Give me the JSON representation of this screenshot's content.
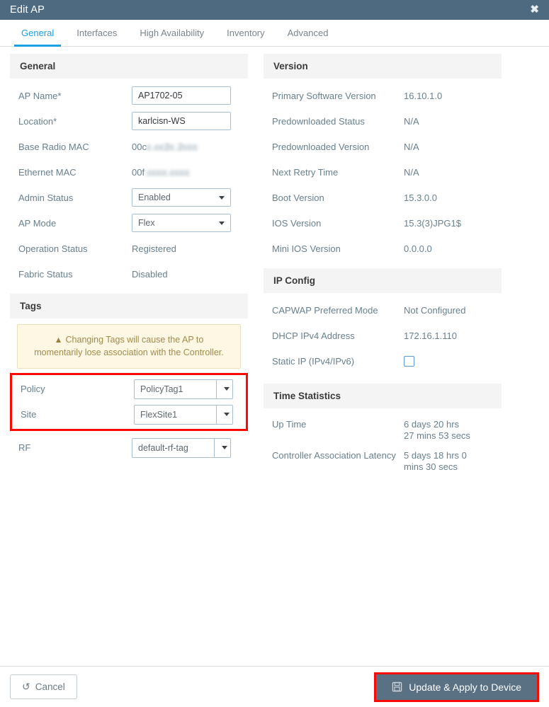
{
  "window": {
    "title": "Edit AP",
    "close_icon": "close-icon"
  },
  "tabs": [
    {
      "label": "General",
      "active": true
    },
    {
      "label": "Interfaces",
      "active": false
    },
    {
      "label": "High Availability",
      "active": false
    },
    {
      "label": "Inventory",
      "active": false
    },
    {
      "label": "Advanced",
      "active": false
    }
  ],
  "left": {
    "general": {
      "header": "General",
      "ap_name_label": "AP Name*",
      "ap_name_value": "AP1702-05",
      "location_label": "Location*",
      "location_value": "karlcisn-WS",
      "base_radio_mac_label": "Base Radio MAC",
      "base_radio_mac_visible": "00c",
      "base_radio_mac_redacted": "c.cc2c.2ccc",
      "ethernet_mac_label": "Ethernet MAC",
      "ethernet_mac_visible": "00f",
      "ethernet_mac_redacted": ".cccc.cccc",
      "admin_status_label": "Admin Status",
      "admin_status_value": "Enabled",
      "ap_mode_label": "AP Mode",
      "ap_mode_value": "Flex",
      "operation_status_label": "Operation Status",
      "operation_status_value": "Registered",
      "fabric_status_label": "Fabric Status",
      "fabric_status_value": "Disabled"
    },
    "tags": {
      "header": "Tags",
      "warning_icon": "warning-triangle-icon",
      "warning_text": "Changing Tags will cause the AP to momentarily lose association with the Controller.",
      "policy_label": "Policy",
      "policy_value": "PolicyTag1",
      "site_label": "Site",
      "site_value": "FlexSite1",
      "rf_label": "RF",
      "rf_value": "default-rf-tag"
    }
  },
  "right": {
    "version": {
      "header": "Version",
      "rows": [
        {
          "label": "Primary Software Version",
          "value": "16.10.1.0"
        },
        {
          "label": "Predownloaded Status",
          "value": "N/A"
        },
        {
          "label": "Predownloaded Version",
          "value": "N/A"
        },
        {
          "label": "Next Retry Time",
          "value": "N/A"
        },
        {
          "label": "Boot Version",
          "value": "15.3.0.0"
        },
        {
          "label": "IOS Version",
          "value": "15.3(3)JPG1$"
        },
        {
          "label": "Mini IOS Version",
          "value": "0.0.0.0"
        }
      ]
    },
    "ip_config": {
      "header": "IP Config",
      "capwap_label": "CAPWAP Preferred Mode",
      "capwap_value": "Not Configured",
      "dhcp_label": "DHCP IPv4 Address",
      "dhcp_value": "172.16.1.110",
      "static_ip_label": "Static IP (IPv4/IPv6)",
      "static_ip_checked": false
    },
    "time_statistics": {
      "header": "Time Statistics",
      "up_time_label": "Up Time",
      "up_time_value": "6 days 20 hrs\n27 mins 53 secs",
      "latency_label": "Controller Association Latency",
      "latency_value": "5 days 18 hrs 0\nmins 30 secs"
    }
  },
  "footer": {
    "cancel_label": "Cancel",
    "cancel_icon": "undo-icon",
    "apply_label": "Update & Apply to Device",
    "apply_icon": "save-icon"
  },
  "colors": {
    "titlebar": "#4e6a80",
    "accent_tab": "#1aa0e0",
    "primary_button": "#5a7184",
    "highlight": "#fa0a05",
    "warning_bg": "#fdf7e3",
    "section_header_bg": "#f4f4f4",
    "label_text": "#69808f"
  }
}
